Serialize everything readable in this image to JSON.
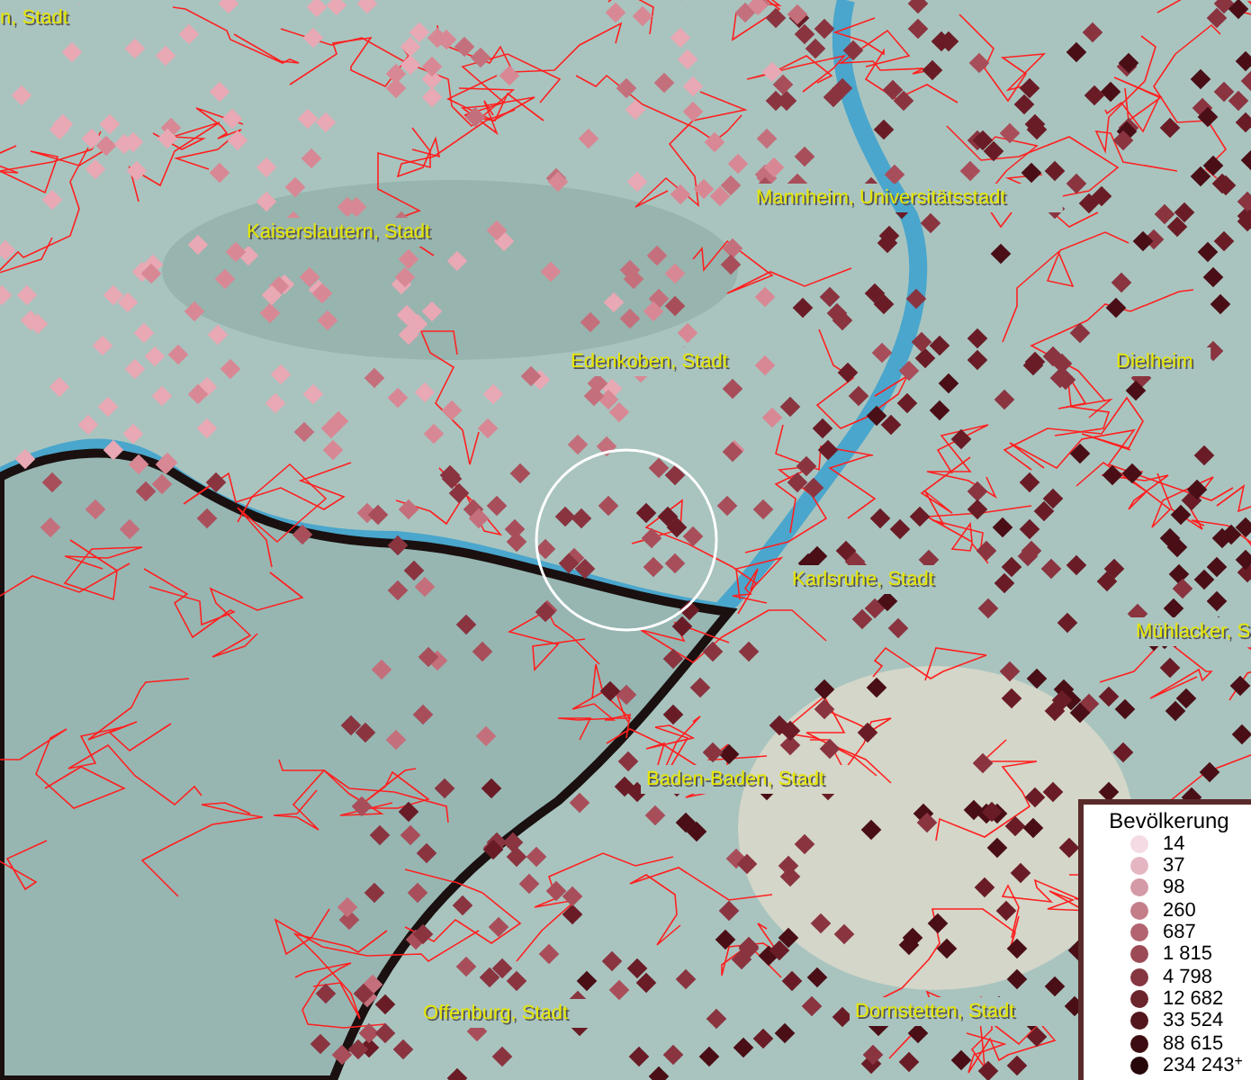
{
  "map": {
    "places": [
      {
        "name": "n, Stadt"
      },
      {
        "name": "Kaiserslautern, Stadt"
      },
      {
        "name": "Mannheim, Universitätsstadt"
      },
      {
        "name": "Edenkoben, Stadt"
      },
      {
        "name": "Dielheim"
      },
      {
        "name": "Karlsruhe, Stadt"
      },
      {
        "name": "Mühlacker, S"
      },
      {
        "name": "Baden-Baden, Stadt"
      },
      {
        "name": "Offenburg, Stadt"
      },
      {
        "name": "Dornstetten, Stadt"
      }
    ]
  },
  "legend": {
    "title": "Bevölkerung",
    "items": [
      {
        "label": "14",
        "color": "#f4dbe4"
      },
      {
        "label": "37",
        "color": "#e4b6c2"
      },
      {
        "label": "98",
        "color": "#d49aa6"
      },
      {
        "label": "260",
        "color": "#c47e8a"
      },
      {
        "label": "687",
        "color": "#b2636f"
      },
      {
        "label": "1 815",
        "color": "#9c4a55"
      },
      {
        "label": "4 798",
        "color": "#853640"
      },
      {
        "label": "12 682",
        "color": "#6c242d"
      },
      {
        "label": "33 524",
        "color": "#53161d"
      },
      {
        "label": "88 615",
        "color": "#3d0c12"
      },
      {
        "label": "234 243$^{+}$",
        "color": "#28070a"
      }
    ]
  }
}
